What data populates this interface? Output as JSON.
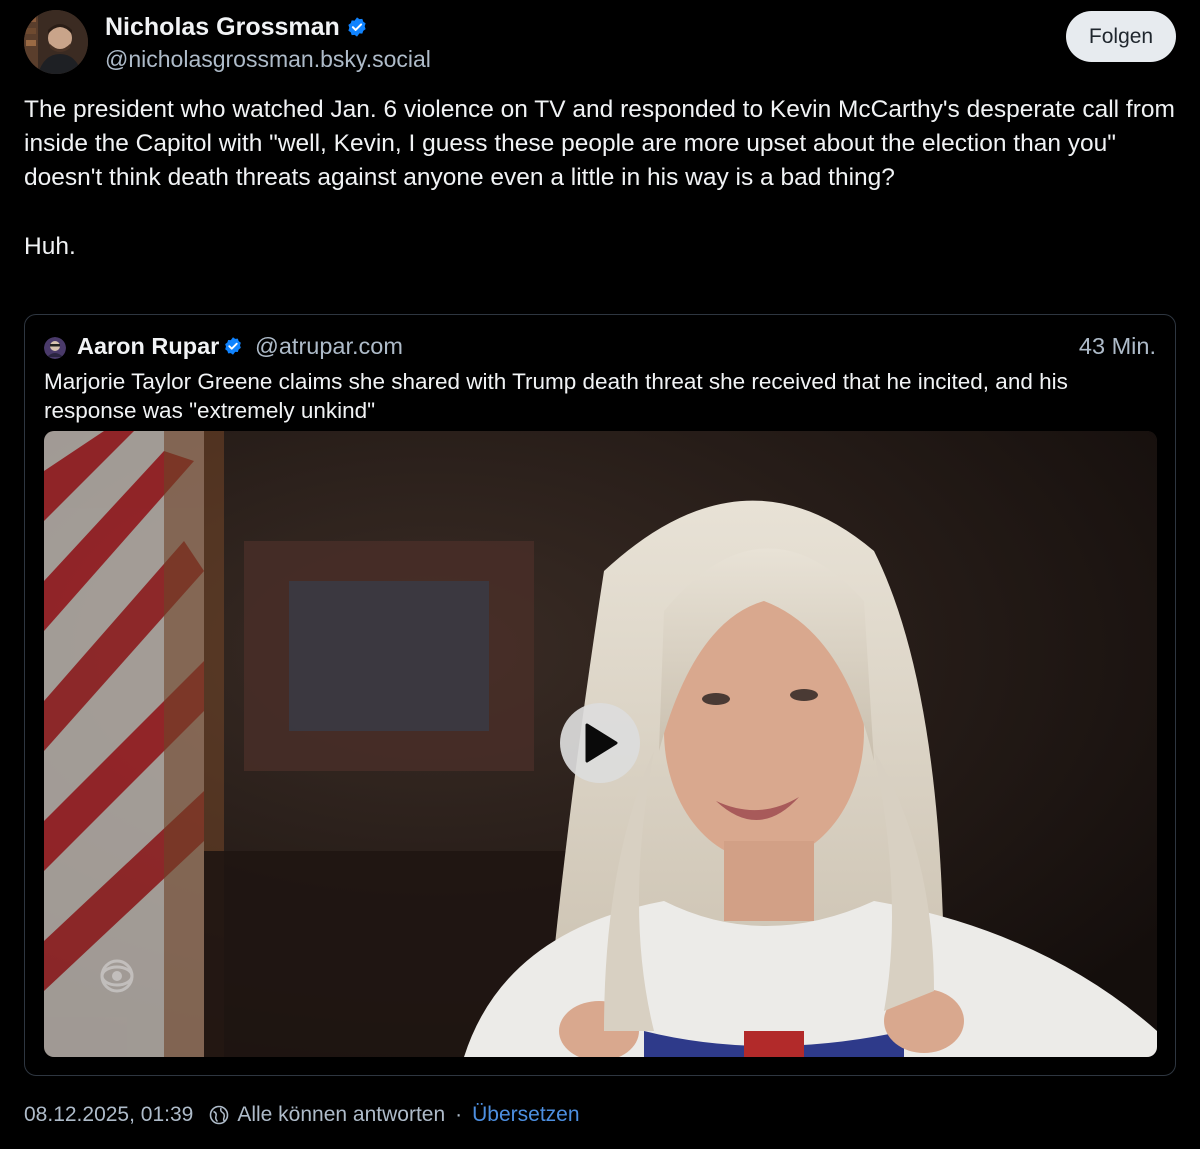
{
  "author": {
    "display_name": "Nicholas Grossman",
    "handle": "@nicholasgrossman.bsky.social",
    "follow_label": "Folgen"
  },
  "post": {
    "paragraph1": "The president who watched Jan. 6 violence on TV and responded to Kevin McCarthy's desperate call from inside the Capitol with \"well, Kevin, I guess these people are more upset about the election than you\" doesn't think death threats against anyone even a little in his way is a bad thing?",
    "paragraph2": "Huh."
  },
  "quote": {
    "display_name": "Aaron Rupar",
    "handle": "@atrupar.com",
    "time": "43 Min.",
    "text": "Marjorie Taylor Greene claims she shared with Trump death threat she received that he incited, and his response was \"extremely unkind\""
  },
  "footer": {
    "timestamp": "08.12.2025, 01:39",
    "reply_setting": "Alle können antworten",
    "separator": "·",
    "translate_label": "Übersetzen"
  },
  "colors": {
    "background": "#000000",
    "text": "#f1f3f5",
    "muted": "#aebbc9",
    "verified": "#1083fe",
    "link": "#4d8fe0"
  },
  "icons": [
    "verified-badge-icon",
    "play-icon",
    "globe-icon",
    "cbs-eye-icon"
  ]
}
